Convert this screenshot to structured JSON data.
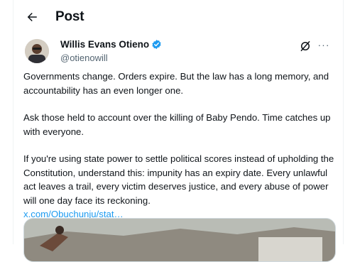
{
  "header": {
    "title": "Post",
    "back_icon": "arrow-left-icon"
  },
  "author": {
    "name": "Willis Evans Otieno",
    "handle": "@otienowill",
    "verified": true,
    "verified_color": "#1d9bf0"
  },
  "actions": {
    "grok_icon": "grok-icon",
    "more_label": "···"
  },
  "post": {
    "paragraphs": [
      "Governments change. Orders expire. But the law has a long memory, and accountability has an even longer one.",
      "Ask those held to account over the killing of Baby Pendo. Time catches up with everyone.",
      "If you're using state power to settle political scores instead of upholding the Constitution, understand this: impunity has an expiry date. Every unlawful act leaves a trail, every victim deserves justice, and every abuse of power will one day face its reckoning."
    ],
    "link": "x.com/Obuchunju/stat…"
  },
  "colors": {
    "link": "#1d9bf0",
    "secondary_text": "#536471"
  }
}
